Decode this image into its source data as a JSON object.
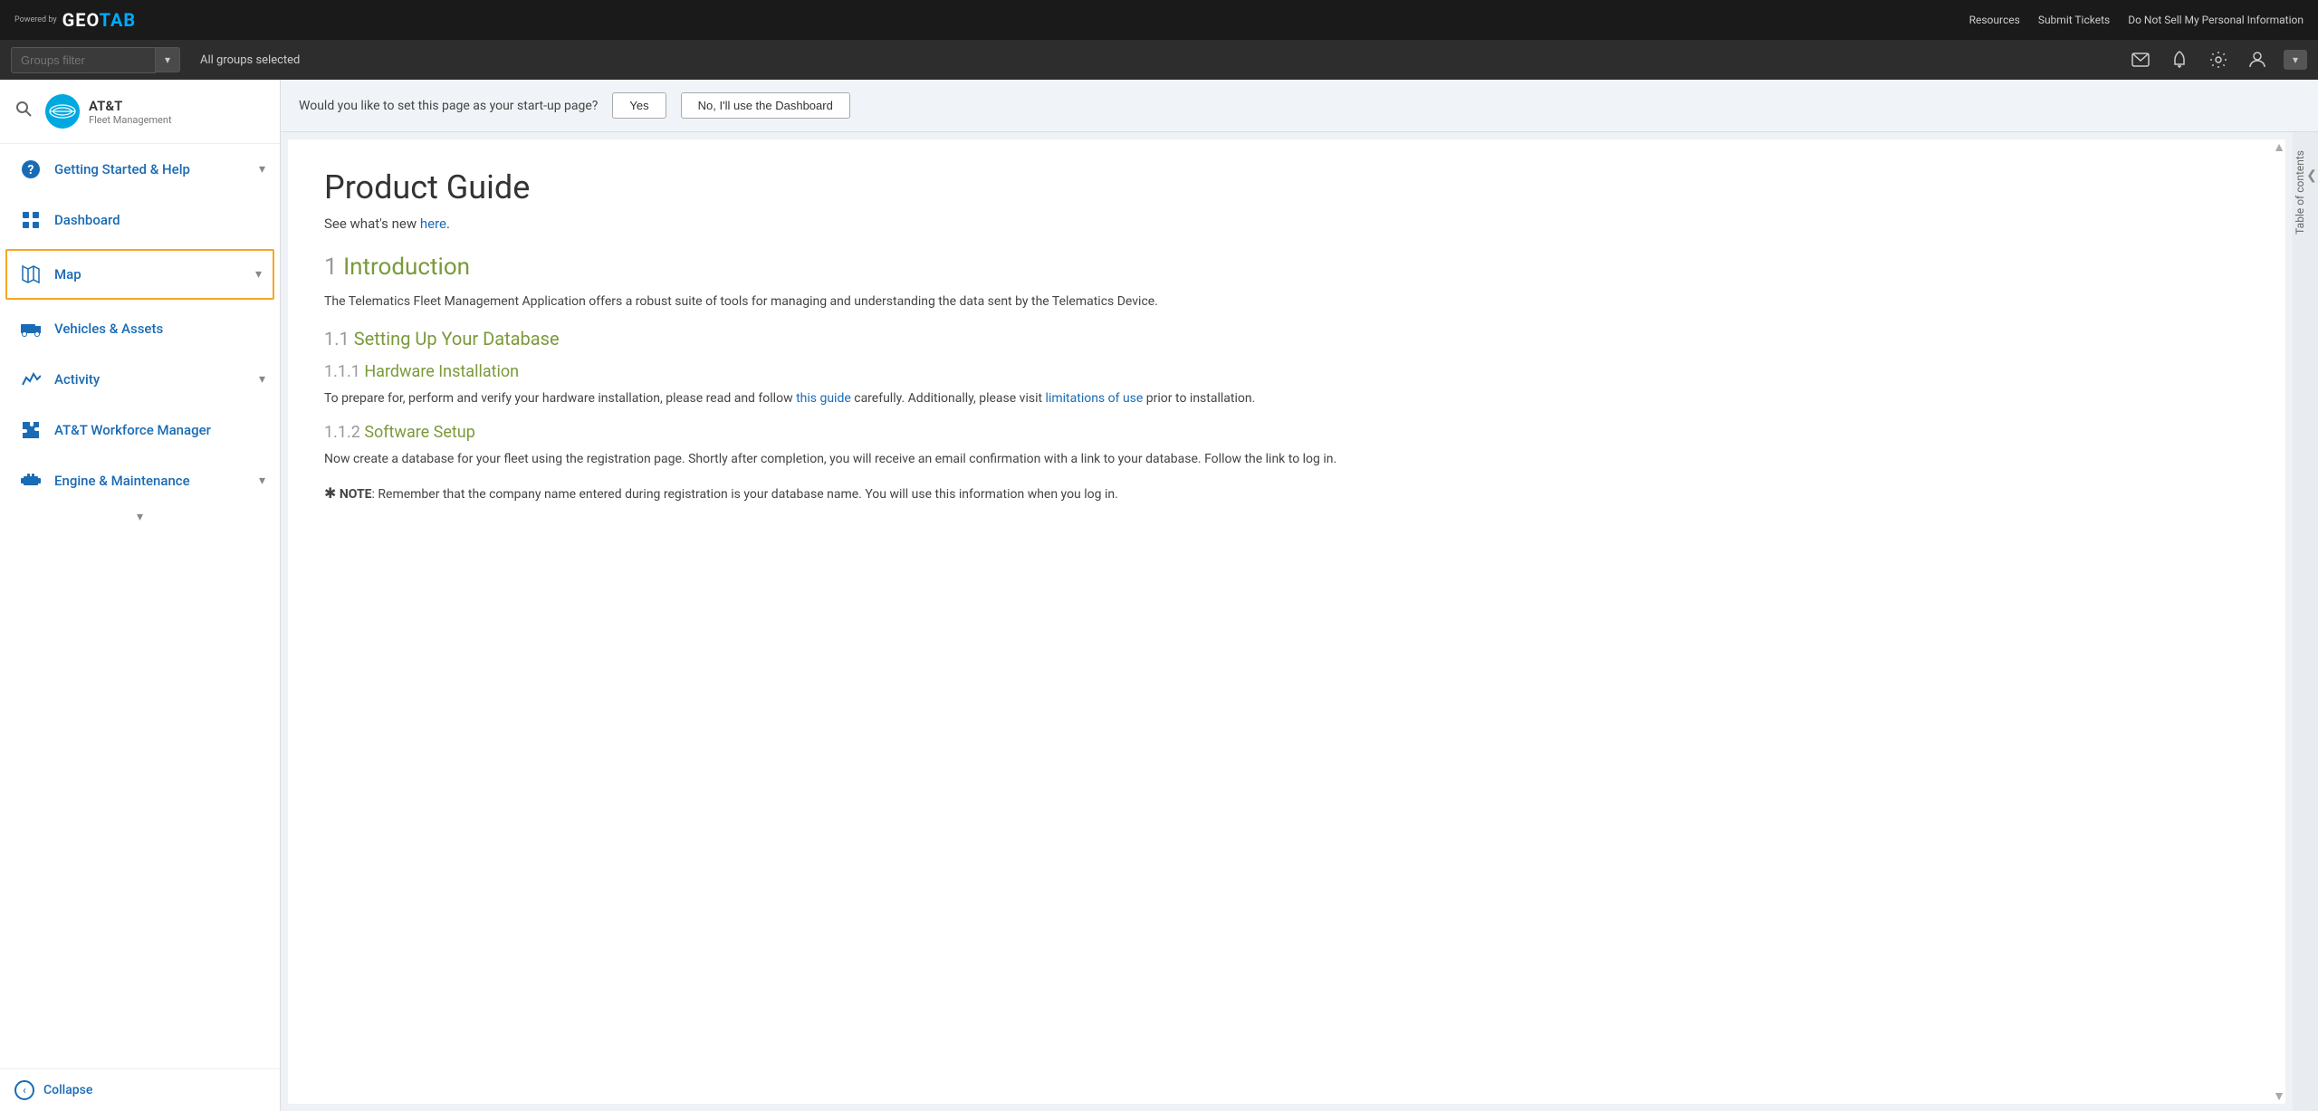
{
  "topbar": {
    "powered_by": "Powered\nby",
    "logo_geo": "GEO",
    "logo_tab": "TAB",
    "logo_full": "GEOTAB",
    "links": [
      "Resources",
      "Submit Tickets",
      "Do Not Sell My Personal Information"
    ]
  },
  "secondbar": {
    "groups_filter_label": "Groups filter",
    "groups_filter_placeholder": "Groups filter",
    "all_groups": "All groups selected",
    "dropdown_arrow": "▾"
  },
  "sidebar": {
    "company_name": "AT&T",
    "company_subtitle": "Fleet Management",
    "nav_items": [
      {
        "id": "getting-started",
        "label": "Getting Started & Help",
        "has_arrow": true,
        "active": false
      },
      {
        "id": "dashboard",
        "label": "Dashboard",
        "has_arrow": false,
        "active": false
      },
      {
        "id": "map",
        "label": "Map",
        "has_arrow": true,
        "active": true
      },
      {
        "id": "vehicles",
        "label": "Vehicles & Assets",
        "has_arrow": false,
        "active": false
      },
      {
        "id": "activity",
        "label": "Activity",
        "has_arrow": true,
        "active": false
      },
      {
        "id": "att-workforce",
        "label": "AT&T Workforce Manager",
        "has_arrow": false,
        "active": false
      },
      {
        "id": "engine",
        "label": "Engine & Maintenance",
        "has_arrow": true,
        "active": false
      }
    ],
    "collapse_label": "Collapse"
  },
  "startup_banner": {
    "text": "Would you like to set this page as your start-up page?",
    "btn_yes": "Yes",
    "btn_no": "No, I'll use the Dashboard"
  },
  "content": {
    "title": "Product Guide",
    "subtitle_pre": "See what's new ",
    "subtitle_link": "here",
    "subtitle_post": ".",
    "sections": [
      {
        "num": "1",
        "title": "Introduction",
        "body": "The Telematics Fleet Management Application offers a robust suite of tools for managing and understanding the data sent by the Telematics Device.",
        "subsections": [
          {
            "num": "1.1",
            "title": "Setting Up Your Database",
            "sub2": [
              {
                "num": "1.1.1",
                "title": "Hardware Installation",
                "body_pre": "To prepare for, perform and verify your hardware installation, please read and follow ",
                "body_link1": "this guide",
                "body_mid": " carefully. Additionally, please visit ",
                "body_link2": "limitations of use",
                "body_post": " prior to installation."
              },
              {
                "num": "1.1.2",
                "title": "Software Setup",
                "body": "Now create a database for your fleet using the registration page. Shortly after completion, you will receive an email confirmation with a link to your database. Follow the link to log in."
              }
            ]
          }
        ]
      }
    ],
    "note": "NOTE: Remember that the company name entered during registration is your database name. You will use this information when you log in.",
    "note_star": "✱"
  },
  "toc": {
    "label": "Table of contents",
    "arrow": "❮"
  }
}
